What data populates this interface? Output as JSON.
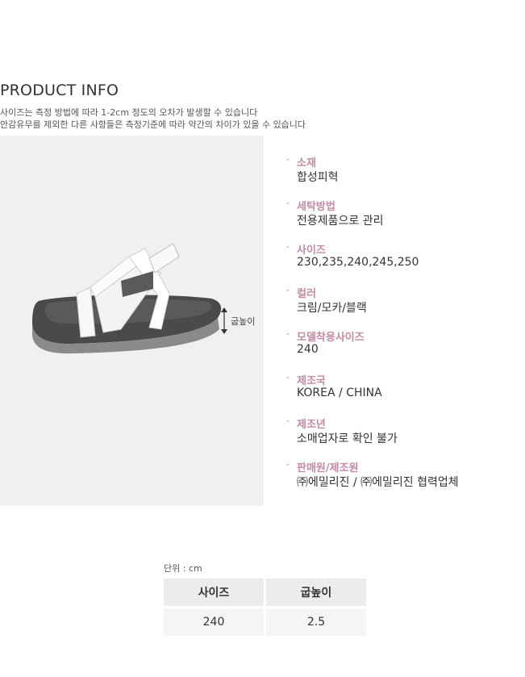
{
  "header": {
    "title": "PRODUCT INFO",
    "note_line1": "사이즈는 측정 방법에 따라 1-2cm 정도의 오차가 발생할 수 있습니다",
    "note_line2": "안감유무를 제외한 다른 사항들은 측정기준에 따라 약간의 차이가 있을 수 있습니다"
  },
  "photo": {
    "heel_label": "굽높이"
  },
  "specs": [
    {
      "bullet": "·",
      "label": " 소재",
      "value": "합성피혁"
    },
    {
      "bullet": "·",
      "label": "세탁방법",
      "value": "전용제품으로 관리"
    },
    {
      "bullet": "·",
      "label": "사이즈",
      "value": "230,235,240,245,250"
    },
    {
      "bullet": "·",
      "label": "컬러",
      "value": "크림/모카/블랙"
    },
    {
      "bullet": "·",
      "label": "모델착용사이즈",
      "value": "240"
    },
    {
      "bullet": "·",
      "label": "제조국",
      "value": "KOREA / CHINA"
    },
    {
      "bullet": "·",
      "label": "제조년",
      "value": "소매업자로 확인 불가"
    },
    {
      "bullet": "·",
      "label": "판매원/제조원",
      "value": "㈜에밀리진 / ㈜에밀리진 협력업체"
    }
  ],
  "size_table": {
    "unit_label": "단위 : cm",
    "headers": [
      "사이즈",
      "굽높이"
    ],
    "rows": [
      [
        "240",
        "2.5"
      ]
    ]
  },
  "colors": {
    "label_accent": "#c68aa4",
    "photo_background": "#f0f0f0",
    "table_header_bg": "#ececec",
    "table_cell_bg": "#f5f5f5"
  }
}
